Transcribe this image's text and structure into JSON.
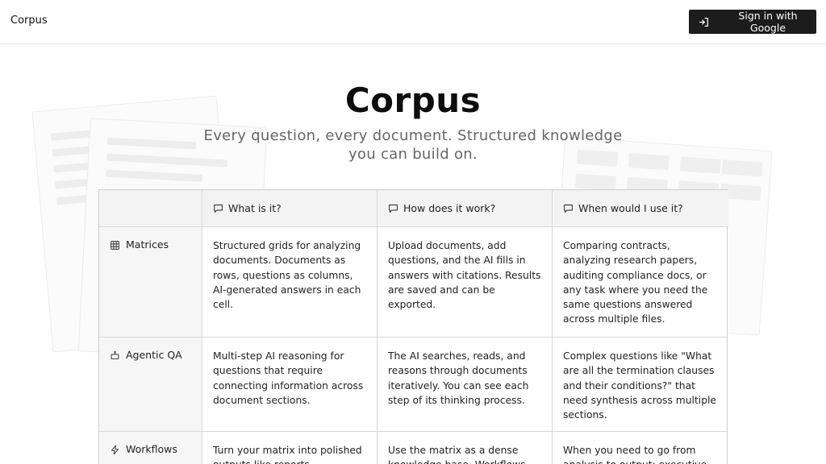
{
  "header": {
    "brand": "Corpus",
    "signin_label": "Sign in with Google",
    "signin_icon": "login-icon"
  },
  "hero": {
    "title": "Corpus",
    "subtitle": "Every question, every document. Structured knowledge you can build on."
  },
  "table": {
    "columns": [
      {
        "label": "What is it?",
        "icon": "message-square-icon"
      },
      {
        "label": "How does it work?",
        "icon": "message-square-icon"
      },
      {
        "label": "When would I use it?",
        "icon": "message-square-icon"
      }
    ],
    "rows": [
      {
        "label": "Matrices",
        "icon": "table-grid-icon",
        "cells": [
          "Structured grids for analyzing documents. Documents as rows, questions as columns, AI-generated answers in each cell.",
          "Upload documents, add questions, and the AI fills in answers with citations. Results are saved and can be exported.",
          "Comparing contracts, analyzing research papers, auditing compliance docs, or any task where you need the same questions answered across multiple files."
        ]
      },
      {
        "label": "Agentic QA",
        "icon": "bot-icon",
        "cells": [
          "Multi-step AI reasoning for questions that require connecting information across document sections.",
          "The AI searches, reads, and reasons through documents iteratively. You can see each step of its thinking process.",
          "Complex questions like \"What are all the termination clauses and their conditions?\" that need synthesis across multiple sections."
        ]
      },
      {
        "label": "Workflows",
        "icon": "lightning-icon",
        "cells": [
          "Turn your matrix into polished outputs like reports, summaries,",
          "Use the matrix as a dense knowledge base. Workflows pull",
          "When you need to go from analysis to output: executive"
        ]
      }
    ]
  }
}
